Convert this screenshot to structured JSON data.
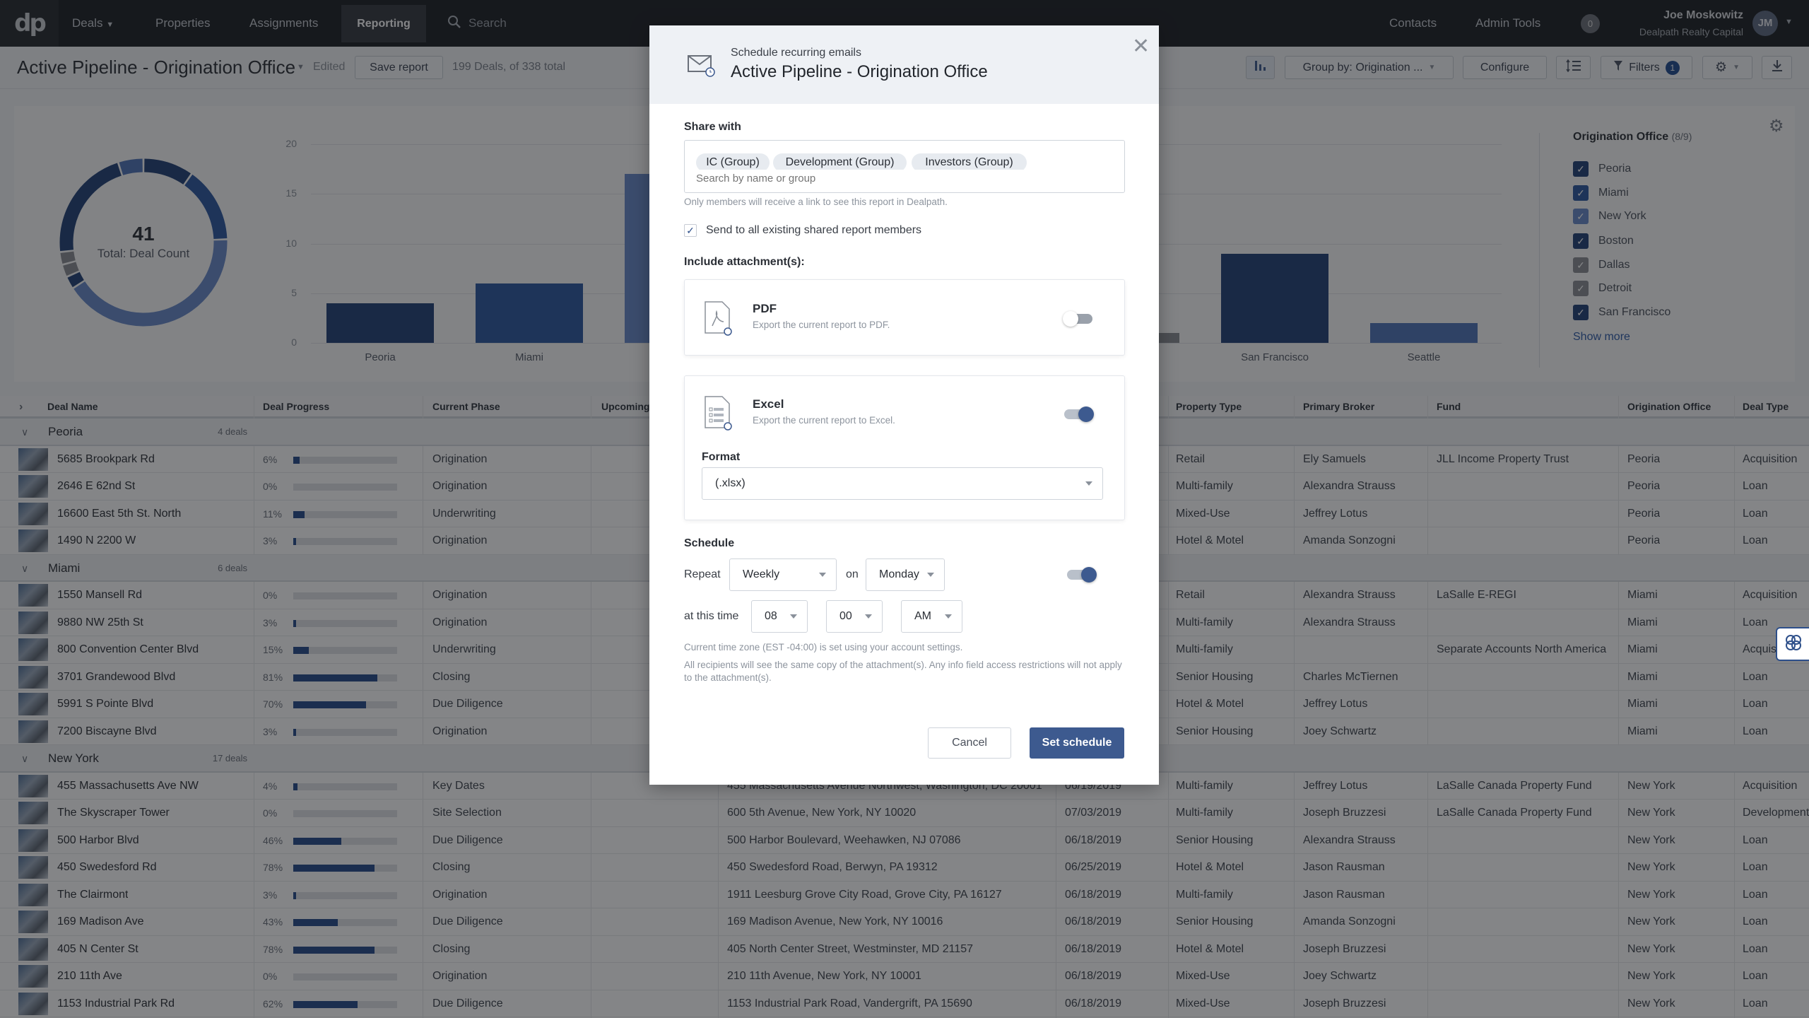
{
  "nav": {
    "logo": "dp",
    "items": [
      "Deals",
      "Properties",
      "Assignments",
      "Reporting"
    ],
    "active": "Reporting",
    "search_placeholder": "Search",
    "right_items": [
      "Contacts",
      "Admin Tools"
    ],
    "notification_count": "0",
    "user_name": "Joe Moskowitz",
    "user_org": "Dealpath Realty Capital",
    "avatar_initials": "JM"
  },
  "toolbar": {
    "title": "Active Pipeline - Origination Office",
    "edited": "Edited",
    "save_label": "Save report",
    "deal_count": "199 Deals, of 338 total",
    "group_by": "Group by: Origination ...",
    "configure": "Configure",
    "filters": "Filters",
    "filters_count": "1"
  },
  "colors": {
    "navy": "#203f75",
    "blue": "#2b56a0",
    "light_blue": "#6688c8",
    "grey": "#8a8d92",
    "accent": "#3d5a8f"
  },
  "chart_data": [
    {
      "type": "pie",
      "center_value": "41",
      "center_label": "Total: Deal Count",
      "categories": [
        "Peoria",
        "Miami",
        "New York",
        "Boston",
        "Dallas",
        "Detroit",
        "San Francisco",
        "Seattle"
      ],
      "values": [
        4,
        6,
        17,
        1,
        1,
        1,
        9,
        2
      ],
      "colors": [
        "#203f75",
        "#2b56a0",
        "#6688c8",
        "#203f75",
        "#8a8d92",
        "#8a8d92",
        "#203f75",
        "#4f73b8"
      ]
    },
    {
      "type": "bar",
      "categories": [
        "Peoria",
        "Miami",
        "New York",
        "Boston",
        "Dallas",
        "Detroit",
        "San Francisco",
        "Seattle"
      ],
      "visible_labels": [
        "Peoria",
        "Miami",
        "",
        "",
        "",
        "",
        "San Francisco",
        "Seattle"
      ],
      "values": [
        4,
        6,
        17,
        null,
        null,
        1,
        9,
        2
      ],
      "colors": [
        "#203f75",
        "#2b56a0",
        "#6688c8",
        "#203f75",
        "#8a8d92",
        "#8a8d92",
        "#203f75",
        "#4f73b8"
      ],
      "yticks": [
        0,
        5,
        10,
        15,
        20
      ],
      "ylim": [
        0,
        20
      ],
      "grid": true
    }
  ],
  "legend": {
    "title": "Origination Office",
    "count": "(8/9)",
    "items": [
      {
        "label": "Peoria",
        "color": "#203f75",
        "checked": true
      },
      {
        "label": "Miami",
        "color": "#2b56a0",
        "checked": true
      },
      {
        "label": "New York",
        "color": "#6688c8",
        "checked": true
      },
      {
        "label": "Boston",
        "color": "#203f75",
        "checked": true
      },
      {
        "label": "Dallas",
        "color": "#8a8d92",
        "checked": true
      },
      {
        "label": "Detroit",
        "color": "#8a8d92",
        "checked": true
      },
      {
        "label": "San Francisco",
        "color": "#203f75",
        "checked": true
      }
    ],
    "show_more": "Show more"
  },
  "table": {
    "columns": [
      "Deal Name",
      "Deal Progress",
      "Current Phase",
      "Upcoming",
      "",
      "",
      "Property Type",
      "Primary Broker",
      "Fund",
      "Origination Office",
      "Deal Type"
    ],
    "groups": [
      {
        "name": "Peoria",
        "count": "4 deals",
        "rows": [
          {
            "name": "5685 Brookpark Rd",
            "progress": 6,
            "phase": "Origination",
            "address": "",
            "date": "",
            "ptype": "Retail",
            "broker": "Ely Samuels",
            "fund": "JLL Income Property Trust",
            "office": "Peoria",
            "dtype": "Acquisition"
          },
          {
            "name": "2646 E 62nd St",
            "progress": 0,
            "phase": "Origination",
            "address": "",
            "date": "",
            "ptype": "Multi-family",
            "broker": "Alexandra Strauss",
            "fund": "",
            "office": "Peoria",
            "dtype": "Loan"
          },
          {
            "name": "16600 East 5th St. North",
            "progress": 11,
            "phase": "Underwriting",
            "address": "",
            "date": "",
            "ptype": "Mixed-Use",
            "broker": "Jeffrey Lotus",
            "fund": "",
            "office": "Peoria",
            "dtype": "Loan"
          },
          {
            "name": "1490 N 2200 W",
            "progress": 3,
            "phase": "Origination",
            "address": "",
            "date": "",
            "ptype": "Hotel & Motel",
            "broker": "Amanda Sonzogni",
            "fund": "",
            "office": "Peoria",
            "dtype": "Loan"
          }
        ]
      },
      {
        "name": "Miami",
        "count": "6 deals",
        "rows": [
          {
            "name": "1550 Mansell Rd",
            "progress": 0,
            "phase": "Origination",
            "address": "",
            "date": "",
            "ptype": "Retail",
            "broker": "Alexandra Strauss",
            "fund": "LaSalle E-REGI",
            "office": "Miami",
            "dtype": "Acquisition"
          },
          {
            "name": "9880 NW 25th St",
            "progress": 3,
            "phase": "Origination",
            "address": "",
            "date": "",
            "ptype": "Multi-family",
            "broker": "Alexandra Strauss",
            "fund": "",
            "office": "Miami",
            "dtype": "Loan"
          },
          {
            "name": "800 Convention Center Blvd",
            "progress": 15,
            "phase": "Underwriting",
            "address": "",
            "date": "",
            "ptype": "Multi-family",
            "broker": "",
            "fund": "Separate Accounts North America",
            "office": "Miami",
            "dtype": "Acquisition"
          },
          {
            "name": "3701 Grandewood Blvd",
            "progress": 81,
            "phase": "Closing",
            "address": "",
            "date": "",
            "ptype": "Senior Housing",
            "broker": "Charles McTiernen",
            "fund": "",
            "office": "Miami",
            "dtype": "Loan"
          },
          {
            "name": "5991 S Pointe Blvd",
            "progress": 70,
            "phase": "Due Diligence",
            "address": "",
            "date": "",
            "ptype": "Hotel & Motel",
            "broker": "Jeffrey Lotus",
            "fund": "",
            "office": "Miami",
            "dtype": "Loan"
          },
          {
            "name": "7200 Biscayne Blvd",
            "progress": 3,
            "phase": "Origination",
            "address": "",
            "date": "",
            "ptype": "Senior Housing",
            "broker": "Joey Schwartz",
            "fund": "",
            "office": "Miami",
            "dtype": "Loan"
          }
        ]
      },
      {
        "name": "New York",
        "count": "17 deals",
        "rows": [
          {
            "name": "455 Massachusetts Ave NW",
            "progress": 4,
            "phase": "Key Dates",
            "address": "455 Massachusetts Avenue Northwest, Washington, DC 20001",
            "date": "06/19/2019",
            "ptype": "Multi-family",
            "broker": "Jeffrey Lotus",
            "fund": "LaSalle Canada Property Fund",
            "office": "New York",
            "dtype": "Acquisition"
          },
          {
            "name": "The Skyscraper Tower",
            "progress": 0,
            "phase": "Site Selection",
            "address": "600 5th Avenue, New York, NY 10020",
            "date": "07/03/2019",
            "ptype": "Multi-family",
            "broker": "Joseph Bruzzesi",
            "fund": "LaSalle Canada Property Fund",
            "office": "New York",
            "dtype": "Development"
          },
          {
            "name": "500 Harbor Blvd",
            "progress": 46,
            "phase": "Due Diligence",
            "address": "500 Harbor Boulevard, Weehawken, NJ 07086",
            "date": "06/18/2019",
            "ptype": "Senior Housing",
            "broker": "Alexandra Strauss",
            "fund": "",
            "office": "New York",
            "dtype": "Loan"
          },
          {
            "name": "450 Swedesford Rd",
            "progress": 78,
            "phase": "Closing",
            "address": "450 Swedesford Road, Berwyn, PA 19312",
            "date": "06/25/2019",
            "ptype": "Hotel & Motel",
            "broker": "Jason Rausman",
            "fund": "",
            "office": "New York",
            "dtype": "Loan"
          },
          {
            "name": "The Clairmont",
            "progress": 3,
            "phase": "Origination",
            "address": "1911 Leesburg Grove City Road, Grove City, PA 16127",
            "date": "06/18/2019",
            "ptype": "Multi-family",
            "broker": "Jason Rausman",
            "fund": "",
            "office": "New York",
            "dtype": "Loan"
          },
          {
            "name": "169 Madison Ave",
            "progress": 43,
            "phase": "Due Diligence",
            "address": "169 Madison Avenue, New York, NY 10016",
            "date": "06/18/2019",
            "ptype": "Senior Housing",
            "broker": "Amanda Sonzogni",
            "fund": "",
            "office": "New York",
            "dtype": "Loan"
          },
          {
            "name": "405 N Center St",
            "progress": 78,
            "phase": "Closing",
            "address": "405 North Center Street, Westminster, MD 21157",
            "date": "06/18/2019",
            "ptype": "Hotel & Motel",
            "broker": "Joseph Bruzzesi",
            "fund": "",
            "office": "New York",
            "dtype": "Loan"
          },
          {
            "name": "210 11th Ave",
            "progress": 0,
            "phase": "Origination",
            "address": "210 11th Avenue, New York, NY 10001",
            "date": "06/18/2019",
            "ptype": "Mixed-Use",
            "broker": "Joey Schwartz",
            "fund": "",
            "office": "New York",
            "dtype": "Loan"
          },
          {
            "name": "1153 Industrial Park Rd",
            "progress": 62,
            "phase": "Due Diligence",
            "address": "1153 Industrial Park Road, Vandergrift, PA 15690",
            "date": "06/18/2019",
            "ptype": "Mixed-Use",
            "broker": "Joseph Bruzzesi",
            "fund": "",
            "office": "New York",
            "dtype": "Loan"
          }
        ]
      }
    ]
  },
  "modal": {
    "subtitle": "Schedule recurring emails",
    "title": "Active Pipeline - Origination Office",
    "share_label": "Share with",
    "chips": [
      "IC (Group)",
      "Development (Group)",
      "Investors (Group)"
    ],
    "search_placeholder": "Search by name or group",
    "share_help": "Only members will receive a link to see this report in Dealpath.",
    "send_all_label": "Send to all existing shared report members",
    "send_all_checked": true,
    "attach_label": "Include attachment(s):",
    "pdf": {
      "title": "PDF",
      "desc": "Export the current report to PDF.",
      "enabled": false
    },
    "excel": {
      "title": "Excel",
      "desc": "Export the current report to Excel.",
      "enabled": true
    },
    "format_label": "Format",
    "format_value": "(.xlsx)",
    "schedule_label": "Schedule",
    "repeat_label": "Repeat",
    "repeat_value": "Weekly",
    "on_label": "on",
    "day_value": "Monday",
    "schedule_enabled": true,
    "time_label": "at this time",
    "hour": "08",
    "minute": "00",
    "ampm": "AM",
    "tz_note": "Current time zone (EST -04:00) is set using your account settings.",
    "recipients_note": "All recipients will see the same copy of the attachment(s). Any info field access restrictions will not apply to the attachment(s).",
    "cancel": "Cancel",
    "submit": "Set schedule"
  }
}
